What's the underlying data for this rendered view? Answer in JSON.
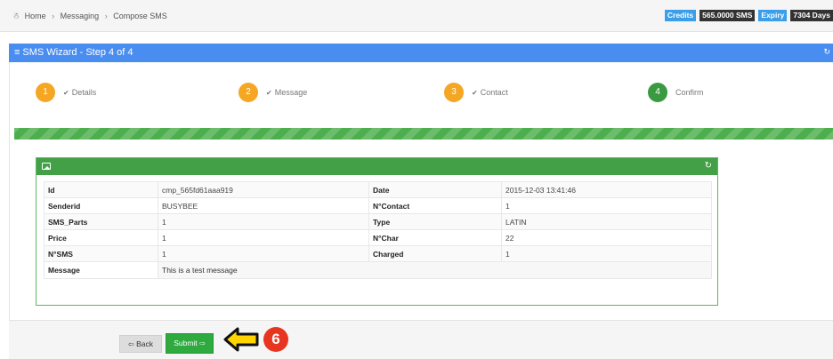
{
  "breadcrumb": {
    "items": [
      "Home",
      "Messaging",
      "Compose SMS"
    ]
  },
  "stats": {
    "credits_label": "Credits",
    "credits_value": "565.0000 SMS",
    "expiry_label": "Expiry",
    "expiry_value": "7304 Days"
  },
  "wizard": {
    "title": "SMS Wizard - Step 4 of 4",
    "steps": [
      {
        "number": "1",
        "label": "Details",
        "completed": true
      },
      {
        "number": "2",
        "label": "Message",
        "completed": true
      },
      {
        "number": "3",
        "label": "Contact",
        "completed": true
      },
      {
        "number": "4",
        "label": "Confirm",
        "completed": false,
        "active": true
      }
    ],
    "progress_percent": 100
  },
  "summary": {
    "rows": [
      {
        "k1": "Id",
        "v1": "cmp_565fd61aaa919",
        "k2": "Date",
        "v2": "2015-12-03 13:41:46"
      },
      {
        "k1": "Senderid",
        "v1": "BUSYBEE",
        "k2": "N°Contact",
        "v2": "1"
      },
      {
        "k1": "SMS_Parts",
        "v1": "1",
        "k2": "Type",
        "v2": "LATIN"
      },
      {
        "k1": "Price",
        "v1": "1",
        "k2": "N°Char",
        "v2": "22"
      },
      {
        "k1": "N°SMS",
        "v1": "1",
        "k2": "Charged",
        "v2": "1"
      }
    ],
    "message_label": "Message",
    "message_value": "This is a test message"
  },
  "footer": {
    "back_label": "Back",
    "submit_label": "Submit"
  },
  "callout": {
    "number": "6"
  },
  "colors": {
    "header_blue": "#4a8df0",
    "step_orange": "#f5a623",
    "step_green": "#3a9a3f",
    "panel_green": "#43a047",
    "submit_green": "#2eaa3f",
    "callout_red": "#e8351f",
    "callout_yellow": "#ffd400"
  },
  "icons": {
    "home": "home-icon",
    "menu": "menu-icon",
    "refresh": "refresh-icon",
    "check": "check-icon",
    "image": "image-icon",
    "back_arrow": "arrow-left-circle-icon",
    "submit_arrow": "arrow-right-circle-icon",
    "callout": "arrow-left-icon"
  }
}
